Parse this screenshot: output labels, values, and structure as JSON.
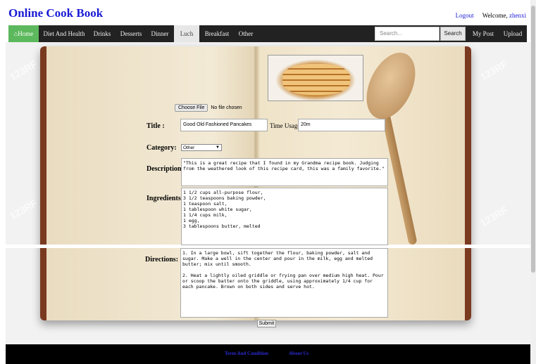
{
  "header": {
    "title": "Online Cook Book",
    "logout": "Logout",
    "welcome": "Welcome,",
    "username": "zhenxi"
  },
  "nav": {
    "home": "Home",
    "items": [
      "Diet And Health",
      "Drinks",
      "Desserts",
      "Dinner",
      "Luch",
      "Breakfast",
      "Other"
    ],
    "active": "Luch",
    "search_placeholder": "Search...",
    "search_button": "Search",
    "my_post": "My Post",
    "upload": "Upload"
  },
  "form": {
    "file_button": "Choose File",
    "file_status": "No file chosen",
    "title_label": "Title :",
    "title_value": "Good Old Fashioned Pancakes",
    "time_label": "Time Usage:",
    "time_value": "20m",
    "category_label": "Category:",
    "category_value": "Other",
    "description_label": "Description:",
    "description_value": "\"This is a great recipe that I found in my Grandma recipe book. Judging from the weathered look of this recipe card, this was a family favorite.\"",
    "ingredients_label": "Ingredients:",
    "ingredients_value": "1 1/2 cups all-purpose flour,\n3 1/2 teaspoons baking powder,\n1 teaspoon salt,\n1 tablespoon white sugar,\n1 1/4 cups milk,\n1 egg,\n3 tablespoons butter, melted",
    "directions_label": "Directions:",
    "directions_value": "1. In a large bowl, sift together the flour, baking powder, salt and sugar. Make a well in the center and pour in the milk, egg and melted butter; mix until smooth.\n\n2. Heat a lightly oiled griddle or frying pan over medium high heat. Pour or scoop the batter onto the griddle, using approximately 1/4 cup for each pancake. Brown on both sides and serve hot.",
    "submit": "Submit"
  },
  "footer": {
    "links": [
      "Term And Condition",
      "About Us"
    ]
  },
  "watermark": "123RF",
  "colors": {
    "brand": "#1a1ad6",
    "nav_bg": "#222222",
    "home_bg": "#5cb85c"
  }
}
